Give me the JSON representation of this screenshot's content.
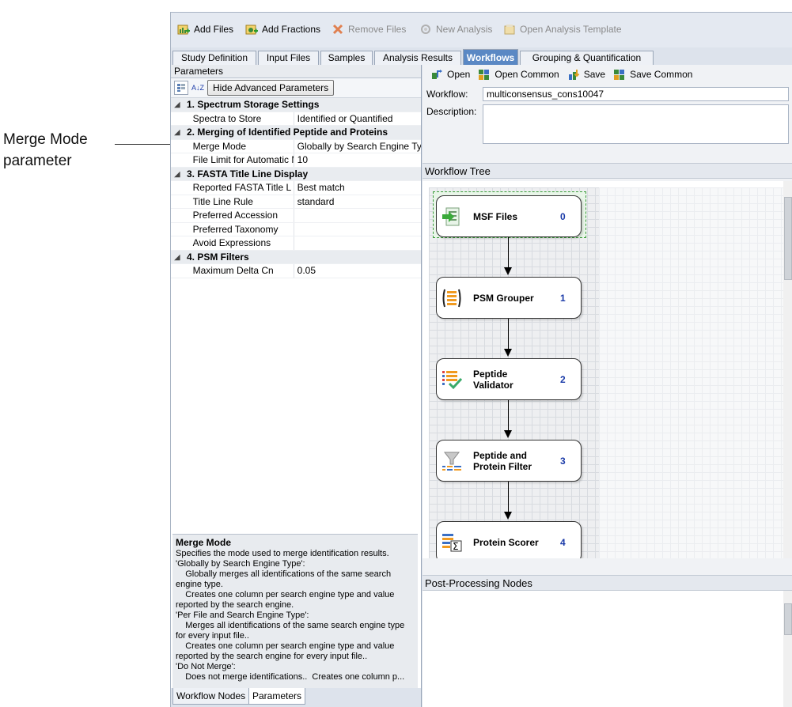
{
  "callout": {
    "line1": "Merge Mode",
    "line2": "parameter"
  },
  "toolbar": {
    "add_files": "Add Files",
    "add_fractions": "Add Fractions",
    "remove_files": "Remove Files",
    "new_analysis": "New Analysis",
    "open_template": "Open Analysis Template"
  },
  "tabs": [
    "Study Definition",
    "Input Files",
    "Samples",
    "Analysis Results",
    "Workflows",
    "Grouping & Quantification"
  ],
  "active_tab": "Workflows",
  "parameters": {
    "title": "Parameters",
    "hide_advanced": "Hide Advanced Parameters",
    "sort_icon_text": "A↓Z",
    "categories": [
      {
        "name": "1. Spectrum Storage Settings",
        "rows": [
          {
            "name": "Spectra to Store",
            "value": "Identified or Quantified"
          }
        ]
      },
      {
        "name": "2. Merging of Identified Peptide and Proteins",
        "rows": [
          {
            "name": "Merge Mode",
            "value": "Globally by Search Engine Type"
          },
          {
            "name": "File Limit for Automatic M",
            "value": "10"
          }
        ]
      },
      {
        "name": "3. FASTA Title Line Display",
        "rows": [
          {
            "name": "Reported FASTA Title L",
            "value": "Best match"
          },
          {
            "name": "Title Line Rule",
            "value": "standard"
          },
          {
            "name": "Preferred Accession",
            "value": ""
          },
          {
            "name": "Preferred Taxonomy",
            "value": ""
          },
          {
            "name": "Avoid Expressions",
            "value": ""
          }
        ]
      },
      {
        "name": "4. PSM Filters",
        "rows": [
          {
            "name": "Maximum Delta Cn",
            "value": "0.05"
          }
        ]
      }
    ]
  },
  "help": {
    "title": "Merge Mode",
    "lines": [
      "Specifies the mode used to merge identification results.",
      "'Globally by Search Engine Type':",
      "    Globally merges all identifications of the same search",
      "engine type.",
      "    Creates one column per search engine type and value",
      "reported by the search engine.",
      "'Per File and Search Engine Type':",
      "    Merges all identifications of the same search engine type",
      "for every input file..",
      "    Creates one column per search engine type and value",
      "reported by the search engine for every input file..",
      "'Do Not Merge':",
      "    Does not merge identifications..  Creates one column p..."
    ]
  },
  "bottom_tabs": [
    "Workflow Nodes",
    "Parameters"
  ],
  "workflow": {
    "open": "Open",
    "open_common": "Open Common",
    "save": "Save",
    "save_common": "Save Common",
    "workflow_label": "Workflow:",
    "workflow_value": "multiconsensus_cons10047",
    "description_label": "Description:",
    "tree_title": "Workflow Tree",
    "post_title": "Post-Processing Nodes",
    "nodes": [
      {
        "label": "MSF Files",
        "num": "0",
        "icon": "msf-files-icon"
      },
      {
        "label": "PSM Grouper",
        "num": "1",
        "icon": "psm-grouper-icon"
      },
      {
        "label": "Peptide\nValidator",
        "num": "2",
        "icon": "peptide-validator-icon"
      },
      {
        "label": "Peptide and\nProtein Filter",
        "num": "3",
        "icon": "filter-icon"
      },
      {
        "label": "Protein Scorer",
        "num": "4",
        "icon": "protein-scorer-icon"
      }
    ]
  },
  "colors": {
    "active_tab": "#5a88c4",
    "node_number": "#1a3aa8",
    "selection": "#3a9d3a"
  }
}
